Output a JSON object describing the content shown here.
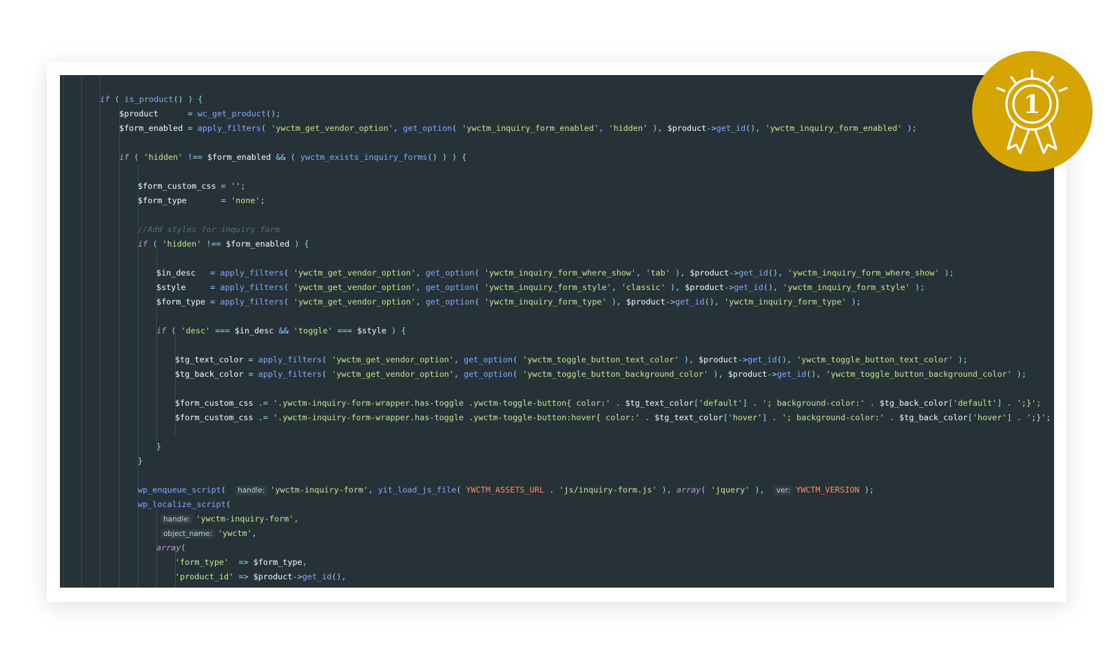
{
  "colors": {
    "editor_bg": "#263238",
    "badge": "#d6a503",
    "keyword": "#c792ea",
    "function": "#82aaff",
    "string": "#c3e88d",
    "operator": "#89ddff",
    "comment": "#546e7a",
    "constant": "#f78c6c"
  },
  "badge": {
    "icon": "first-place-award-icon",
    "number": "1"
  },
  "code_lines": [
    [
      {
        "t": "if",
        "c": "kw"
      },
      {
        "t": " ( ",
        "c": "pun"
      },
      {
        "t": "is_product",
        "c": "fn"
      },
      {
        "t": "() ) {",
        "c": "pun"
      }
    ],
    [
      {
        "t": "$product",
        "c": "var"
      },
      {
        "t": "      = ",
        "c": "op"
      },
      {
        "t": "wc_get_product",
        "c": "fn"
      },
      {
        "t": "();",
        "c": "pun"
      }
    ],
    [
      {
        "t": "$form_enabled",
        "c": "var"
      },
      {
        "t": " = ",
        "c": "op"
      },
      {
        "t": "apply_filters",
        "c": "fn"
      },
      {
        "t": "( ",
        "c": "pun"
      },
      {
        "t": "'ywctm_get_vendor_option'",
        "c": "str"
      },
      {
        "t": ", ",
        "c": "pun"
      },
      {
        "t": "get_option",
        "c": "fn"
      },
      {
        "t": "( ",
        "c": "pun"
      },
      {
        "t": "'ywctm_inquiry_form_enabled'",
        "c": "str"
      },
      {
        "t": ", ",
        "c": "pun"
      },
      {
        "t": "'hidden'",
        "c": "str"
      },
      {
        "t": " ), ",
        "c": "pun"
      },
      {
        "t": "$product",
        "c": "var"
      },
      {
        "t": "->",
        "c": "op"
      },
      {
        "t": "get_id",
        "c": "fn"
      },
      {
        "t": "(), ",
        "c": "pun"
      },
      {
        "t": "'ywctm_inquiry_form_enabled'",
        "c": "str"
      },
      {
        "t": " );",
        "c": "pun"
      }
    ],
    [],
    [
      {
        "t": "if",
        "c": "kw"
      },
      {
        "t": " ( ",
        "c": "pun"
      },
      {
        "t": "'hidden'",
        "c": "str"
      },
      {
        "t": " !== ",
        "c": "op"
      },
      {
        "t": "$form_enabled",
        "c": "var"
      },
      {
        "t": " && ",
        "c": "op"
      },
      {
        "t": "( ",
        "c": "pun"
      },
      {
        "t": "ywctm_exists_inquiry_forms",
        "c": "fn"
      },
      {
        "t": "() ) ) {",
        "c": "pun"
      }
    ],
    [],
    [
      {
        "t": "$form_custom_css",
        "c": "var"
      },
      {
        "t": " = ",
        "c": "op"
      },
      {
        "t": "''",
        "c": "str"
      },
      {
        "t": ";",
        "c": "pun"
      }
    ],
    [
      {
        "t": "$form_type",
        "c": "var"
      },
      {
        "t": "       = ",
        "c": "op"
      },
      {
        "t": "'none'",
        "c": "str"
      },
      {
        "t": ";",
        "c": "pun"
      }
    ],
    [],
    [
      {
        "t": "//Add styles for inquiry form",
        "c": "cmt"
      }
    ],
    [
      {
        "t": "if",
        "c": "kw"
      },
      {
        "t": " ( ",
        "c": "pun"
      },
      {
        "t": "'hidden'",
        "c": "str"
      },
      {
        "t": " !== ",
        "c": "op"
      },
      {
        "t": "$form_enabled",
        "c": "var"
      },
      {
        "t": " ) {",
        "c": "pun"
      }
    ],
    [],
    [
      {
        "t": "$in_desc",
        "c": "var"
      },
      {
        "t": "   = ",
        "c": "op"
      },
      {
        "t": "apply_filters",
        "c": "fn"
      },
      {
        "t": "( ",
        "c": "pun"
      },
      {
        "t": "'ywctm_get_vendor_option'",
        "c": "str"
      },
      {
        "t": ", ",
        "c": "pun"
      },
      {
        "t": "get_option",
        "c": "fn"
      },
      {
        "t": "( ",
        "c": "pun"
      },
      {
        "t": "'ywctm_inquiry_form_where_show'",
        "c": "str"
      },
      {
        "t": ", ",
        "c": "pun"
      },
      {
        "t": "'tab'",
        "c": "str"
      },
      {
        "t": " ), ",
        "c": "pun"
      },
      {
        "t": "$product",
        "c": "var"
      },
      {
        "t": "->",
        "c": "op"
      },
      {
        "t": "get_id",
        "c": "fn"
      },
      {
        "t": "(), ",
        "c": "pun"
      },
      {
        "t": "'ywctm_inquiry_form_where_show'",
        "c": "str"
      },
      {
        "t": " );",
        "c": "pun"
      }
    ],
    [
      {
        "t": "$style",
        "c": "var"
      },
      {
        "t": "     = ",
        "c": "op"
      },
      {
        "t": "apply_filters",
        "c": "fn"
      },
      {
        "t": "( ",
        "c": "pun"
      },
      {
        "t": "'ywctm_get_vendor_option'",
        "c": "str"
      },
      {
        "t": ", ",
        "c": "pun"
      },
      {
        "t": "get_option",
        "c": "fn"
      },
      {
        "t": "( ",
        "c": "pun"
      },
      {
        "t": "'ywctm_inquiry_form_style'",
        "c": "str"
      },
      {
        "t": ", ",
        "c": "pun"
      },
      {
        "t": "'classic'",
        "c": "str"
      },
      {
        "t": " ), ",
        "c": "pun"
      },
      {
        "t": "$product",
        "c": "var"
      },
      {
        "t": "->",
        "c": "op"
      },
      {
        "t": "get_id",
        "c": "fn"
      },
      {
        "t": "(), ",
        "c": "pun"
      },
      {
        "t": "'ywctm_inquiry_form_style'",
        "c": "str"
      },
      {
        "t": " );",
        "c": "pun"
      }
    ],
    [
      {
        "t": "$form_type",
        "c": "var"
      },
      {
        "t": " = ",
        "c": "op"
      },
      {
        "t": "apply_filters",
        "c": "fn"
      },
      {
        "t": "( ",
        "c": "pun"
      },
      {
        "t": "'ywctm_get_vendor_option'",
        "c": "str"
      },
      {
        "t": ", ",
        "c": "pun"
      },
      {
        "t": "get_option",
        "c": "fn"
      },
      {
        "t": "( ",
        "c": "pun"
      },
      {
        "t": "'ywctm_inquiry_form_type'",
        "c": "str"
      },
      {
        "t": " ), ",
        "c": "pun"
      },
      {
        "t": "$product",
        "c": "var"
      },
      {
        "t": "->",
        "c": "op"
      },
      {
        "t": "get_id",
        "c": "fn"
      },
      {
        "t": "(), ",
        "c": "pun"
      },
      {
        "t": "'ywctm_inquiry_form_type'",
        "c": "str"
      },
      {
        "t": " );",
        "c": "pun"
      }
    ],
    [],
    [
      {
        "t": "if",
        "c": "kw"
      },
      {
        "t": " ( ",
        "c": "pun"
      },
      {
        "t": "'desc'",
        "c": "str"
      },
      {
        "t": " === ",
        "c": "op"
      },
      {
        "t": "$in_desc",
        "c": "var"
      },
      {
        "t": " && ",
        "c": "op"
      },
      {
        "t": "'toggle'",
        "c": "str"
      },
      {
        "t": " === ",
        "c": "op"
      },
      {
        "t": "$style",
        "c": "var"
      },
      {
        "t": " ) {",
        "c": "pun"
      }
    ],
    [],
    [
      {
        "t": "$tg_text_color",
        "c": "var"
      },
      {
        "t": " = ",
        "c": "op"
      },
      {
        "t": "apply_filters",
        "c": "fn"
      },
      {
        "t": "( ",
        "c": "pun"
      },
      {
        "t": "'ywctm_get_vendor_option'",
        "c": "str"
      },
      {
        "t": ", ",
        "c": "pun"
      },
      {
        "t": "get_option",
        "c": "fn"
      },
      {
        "t": "( ",
        "c": "pun"
      },
      {
        "t": "'ywctm_toggle_button_text_color'",
        "c": "str"
      },
      {
        "t": " ), ",
        "c": "pun"
      },
      {
        "t": "$product",
        "c": "var"
      },
      {
        "t": "->",
        "c": "op"
      },
      {
        "t": "get_id",
        "c": "fn"
      },
      {
        "t": "(), ",
        "c": "pun"
      },
      {
        "t": "'ywctm_toggle_button_text_color'",
        "c": "str"
      },
      {
        "t": " );",
        "c": "pun"
      }
    ],
    [
      {
        "t": "$tg_back_color",
        "c": "var"
      },
      {
        "t": " = ",
        "c": "op"
      },
      {
        "t": "apply_filters",
        "c": "fn"
      },
      {
        "t": "( ",
        "c": "pun"
      },
      {
        "t": "'ywctm_get_vendor_option'",
        "c": "str"
      },
      {
        "t": ", ",
        "c": "pun"
      },
      {
        "t": "get_option",
        "c": "fn"
      },
      {
        "t": "( ",
        "c": "pun"
      },
      {
        "t": "'ywctm_toggle_button_background_color'",
        "c": "str"
      },
      {
        "t": " ), ",
        "c": "pun"
      },
      {
        "t": "$product",
        "c": "var"
      },
      {
        "t": "->",
        "c": "op"
      },
      {
        "t": "get_id",
        "c": "fn"
      },
      {
        "t": "(), ",
        "c": "pun"
      },
      {
        "t": "'ywctm_toggle_button_background_color'",
        "c": "str"
      },
      {
        "t": " );",
        "c": "pun"
      }
    ],
    [],
    [
      {
        "t": "$form_custom_css",
        "c": "var"
      },
      {
        "t": " .= ",
        "c": "op"
      },
      {
        "t": "'.ywctm-inquiry-form-wrapper.has-toggle .ywctm-toggle-button{ color:'",
        "c": "str"
      },
      {
        "t": " . ",
        "c": "op"
      },
      {
        "t": "$tg_text_color",
        "c": "var"
      },
      {
        "t": "[",
        "c": "pun"
      },
      {
        "t": "'default'",
        "c": "str"
      },
      {
        "t": "] . ",
        "c": "pun"
      },
      {
        "t": "'; background-color:'",
        "c": "str"
      },
      {
        "t": " . ",
        "c": "op"
      },
      {
        "t": "$tg_back_color",
        "c": "var"
      },
      {
        "t": "[",
        "c": "pun"
      },
      {
        "t": "'default'",
        "c": "str"
      },
      {
        "t": "] . ",
        "c": "pun"
      },
      {
        "t": "';}'",
        "c": "str"
      },
      {
        "t": ";",
        "c": "pun"
      }
    ],
    [
      {
        "t": "$form_custom_css",
        "c": "var"
      },
      {
        "t": " .= ",
        "c": "op"
      },
      {
        "t": "'.ywctm-inquiry-form-wrapper.has-toggle .ywctm-toggle-button:hover{ color:'",
        "c": "str"
      },
      {
        "t": " . ",
        "c": "op"
      },
      {
        "t": "$tg_text_color",
        "c": "var"
      },
      {
        "t": "[",
        "c": "pun"
      },
      {
        "t": "'hover'",
        "c": "str"
      },
      {
        "t": "] . ",
        "c": "pun"
      },
      {
        "t": "'; background-color:'",
        "c": "str"
      },
      {
        "t": " . ",
        "c": "op"
      },
      {
        "t": "$tg_back_color",
        "c": "var"
      },
      {
        "t": "[",
        "c": "pun"
      },
      {
        "t": "'hover'",
        "c": "str"
      },
      {
        "t": "] . ",
        "c": "pun"
      },
      {
        "t": "';}'",
        "c": "str"
      },
      {
        "t": ";",
        "c": "pun"
      }
    ],
    [],
    [
      {
        "t": "}",
        "c": "pun"
      }
    ],
    [
      {
        "t": "}",
        "c": "pun"
      }
    ],
    [],
    [
      {
        "t": "wp_enqueue_script",
        "c": "fn"
      },
      {
        "t": "( ",
        "c": "pun"
      },
      {
        "t": "handle:",
        "c": "hint"
      },
      {
        "t": "'ywctm-inquiry-form'",
        "c": "str"
      },
      {
        "t": ", ",
        "c": "pun"
      },
      {
        "t": "yit_load_js_file",
        "c": "fn"
      },
      {
        "t": "( ",
        "c": "pun"
      },
      {
        "t": "YWCTM_ASSETS_URL",
        "c": "const"
      },
      {
        "t": " . ",
        "c": "op"
      },
      {
        "t": "'js/inquiry-form.js'",
        "c": "str"
      },
      {
        "t": " ), ",
        "c": "pun"
      },
      {
        "t": "array",
        "c": "kw"
      },
      {
        "t": "( ",
        "c": "pun"
      },
      {
        "t": "'jquery'",
        "c": "str"
      },
      {
        "t": " ), ",
        "c": "pun"
      },
      {
        "t": "ver:",
        "c": "hint"
      },
      {
        "t": "YWCTM_VERSION",
        "c": "const"
      },
      {
        "t": " );",
        "c": "pun"
      }
    ],
    [
      {
        "t": "wp_localize_script",
        "c": "fn"
      },
      {
        "t": "(",
        "c": "pun"
      }
    ],
    [
      {
        "t": "handle:",
        "c": "hint"
      },
      {
        "t": "'ywctm-inquiry-form'",
        "c": "str"
      },
      {
        "t": ",",
        "c": "pun"
      }
    ],
    [
      {
        "t": "object_name:",
        "c": "hint"
      },
      {
        "t": "'ywctm'",
        "c": "str"
      },
      {
        "t": ",",
        "c": "pun"
      }
    ],
    [
      {
        "t": "array",
        "c": "kw"
      },
      {
        "t": "(",
        "c": "pun"
      }
    ],
    [
      {
        "t": "'form_type'",
        "c": "str"
      },
      {
        "t": "  => ",
        "c": "op"
      },
      {
        "t": "$form_type",
        "c": "var"
      },
      {
        "t": ",",
        "c": "pun"
      }
    ],
    [
      {
        "t": "'product_id'",
        "c": "str"
      },
      {
        "t": " => ",
        "c": "op"
      },
      {
        "t": "$product",
        "c": "var"
      },
      {
        "t": "->",
        "c": "op"
      },
      {
        "t": "get_id",
        "c": "fn"
      },
      {
        "t": "(),",
        "c": "pun"
      }
    ]
  ]
}
